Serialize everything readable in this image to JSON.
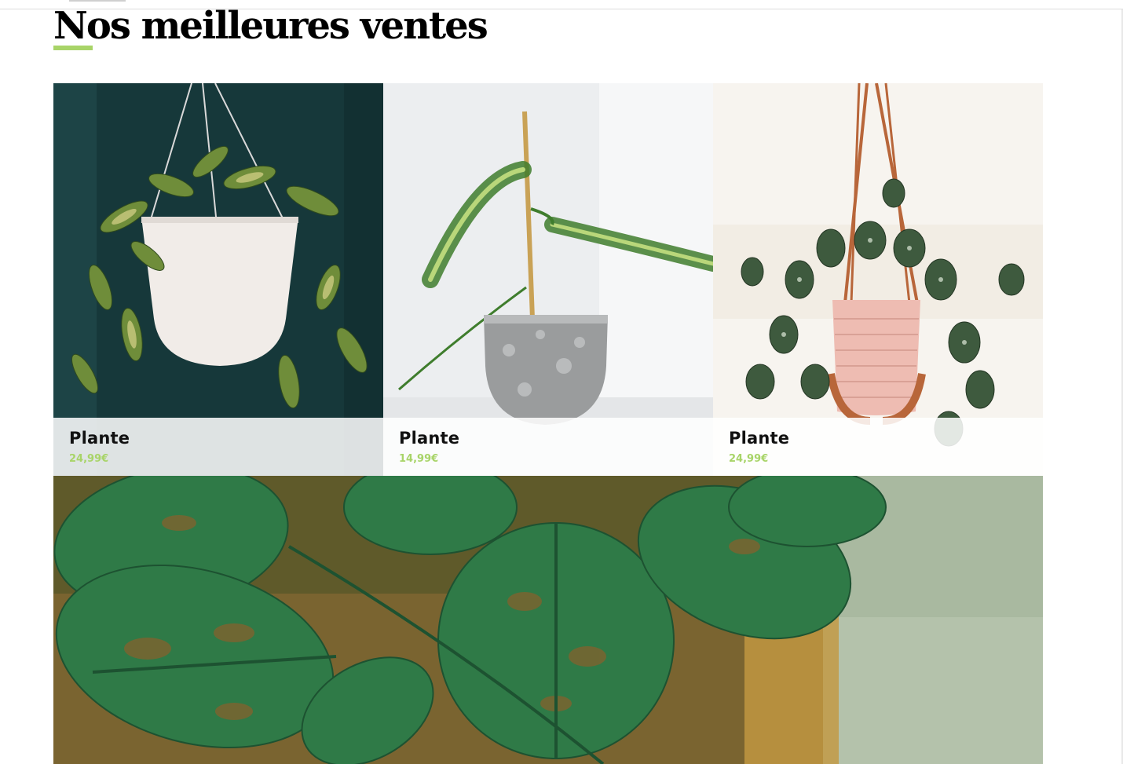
{
  "section": {
    "title": "Nos meilleures ventes"
  },
  "theme": {
    "accent": "#a8d468",
    "price_color": "#a8d468",
    "text": "#111111"
  },
  "products": [
    {
      "name": "Plante",
      "price": "24,99€",
      "image": "hoya-hanging-white-pot"
    },
    {
      "name": "Plante",
      "price": "14,99€",
      "image": "vanilla-orchid-grey-pot"
    },
    {
      "name": "Plante",
      "price": "24,99€",
      "image": "scindapsus-hanging-pink-pot"
    }
  ],
  "banner": {
    "image": "monstera-adansonii-closeup"
  }
}
